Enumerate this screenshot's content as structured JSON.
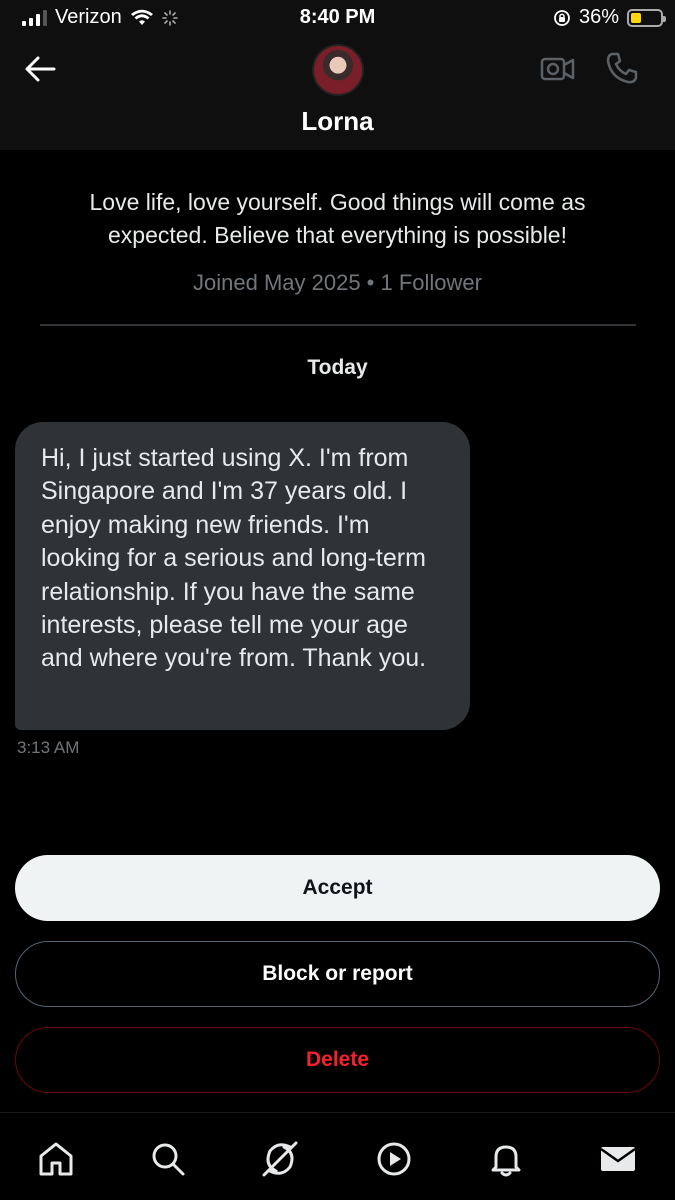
{
  "status_bar": {
    "carrier": "Verizon",
    "time": "8:40 PM",
    "battery": "36%",
    "battery_level": 0.36
  },
  "header": {
    "name": "Lorna"
  },
  "profile": {
    "bio": "Love life, love yourself. Good things will come as expected. Believe that everything is possible!",
    "joined": "Joined May 2025 • 1 Follower"
  },
  "conversation": {
    "date_label": "Today",
    "message": {
      "text": "Hi, I just started using X. I'm from Singapore and I'm 37 years old. I enjoy making new friends. I'm looking for a serious and long-term relationship. If you have the same interests, please tell me your age and where you're from. Thank you.",
      "time": "3:13 AM"
    }
  },
  "actions": {
    "accept": "Accept",
    "block": "Block or report",
    "delete": "Delete"
  },
  "colors": {
    "accept_bg": "#eff3f4",
    "delete_text": "#f4212e",
    "bubble_bg": "#2f3336",
    "muted_text": "#71767b"
  },
  "icons": {
    "nav": [
      "home-icon",
      "search-icon",
      "grok-icon",
      "video-play-icon",
      "notifications-bell-icon",
      "messages-envelope-icon"
    ]
  }
}
